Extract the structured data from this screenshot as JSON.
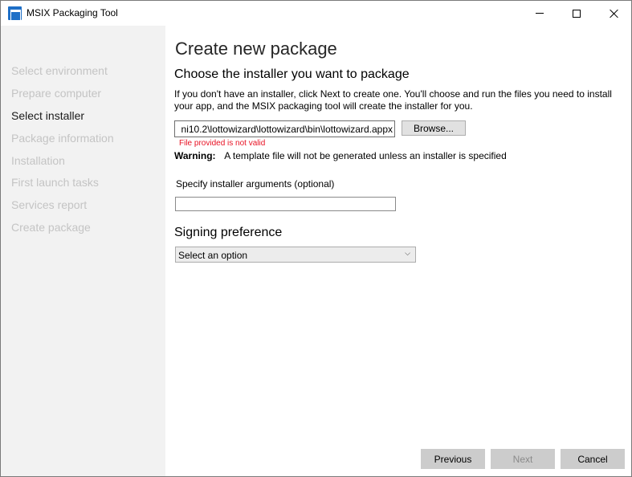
{
  "window": {
    "title": "MSIX Packaging Tool",
    "icon": "msix-packaging-tool-icon"
  },
  "sidebar": {
    "steps": [
      {
        "label": "Select environment",
        "state": "disabled"
      },
      {
        "label": "Prepare computer",
        "state": "disabled"
      },
      {
        "label": "Select installer",
        "state": "active"
      },
      {
        "label": "Package information",
        "state": "disabled"
      },
      {
        "label": "Installation",
        "state": "disabled"
      },
      {
        "label": "First launch tasks",
        "state": "disabled"
      },
      {
        "label": "Services report",
        "state": "disabled"
      },
      {
        "label": "Create package",
        "state": "disabled"
      }
    ]
  },
  "main": {
    "page_title": "Create new package",
    "installer_heading": "Choose the installer you want to package",
    "installer_description": "If you don't have an installer, click Next to create one. You'll choose and run the files you need to install your app, and the MSIX packaging tool will create the installer for you.",
    "installer_path_value": "ni10.2\\lottowizard\\lottowizard\\bin\\lottowizard.appx",
    "browse_label": "Browse...",
    "error_text": "File provided is not valid",
    "warning_label": "Warning:",
    "warning_text": "A template file will not be generated unless an installer is specified",
    "args_label": "Specify installer arguments (optional)",
    "args_value": "",
    "signing_heading": "Signing preference",
    "signing_selected": "Select an option"
  },
  "footer": {
    "previous_label": "Previous",
    "next_label": "Next",
    "cancel_label": "Cancel"
  },
  "colors": {
    "sidebar_bg": "#f2f2f2",
    "error": "#e81123",
    "accent": "#1e6fc7",
    "button_bg": "#cccccc"
  }
}
